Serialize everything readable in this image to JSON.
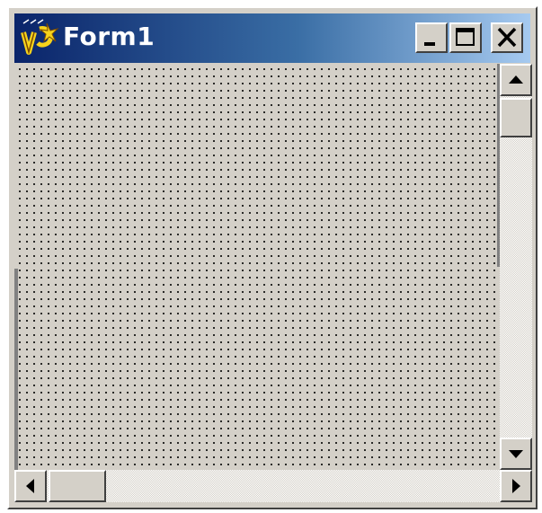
{
  "window": {
    "title": "Form1",
    "icon": "visual-basic-form-icon"
  },
  "caption_buttons": [
    {
      "name": "minimize-button",
      "icon": "minimize-icon"
    },
    {
      "name": "maximize-button",
      "icon": "maximize-icon"
    },
    {
      "name": "close-button",
      "icon": "close-icon"
    }
  ],
  "client_area": {
    "pattern": "design-grid-dots"
  },
  "vertical_scrollbar": {
    "up_icon": "arrow-up-icon",
    "down_icon": "arrow-down-icon",
    "position": 0
  },
  "horizontal_scrollbar": {
    "left_icon": "arrow-left-icon",
    "right_icon": "arrow-right-icon",
    "position": 0
  },
  "colors": {
    "face": "#d4d0c8",
    "title_start": "#0a246a",
    "title_end": "#a6caf0",
    "title_text": "#ffffff"
  }
}
